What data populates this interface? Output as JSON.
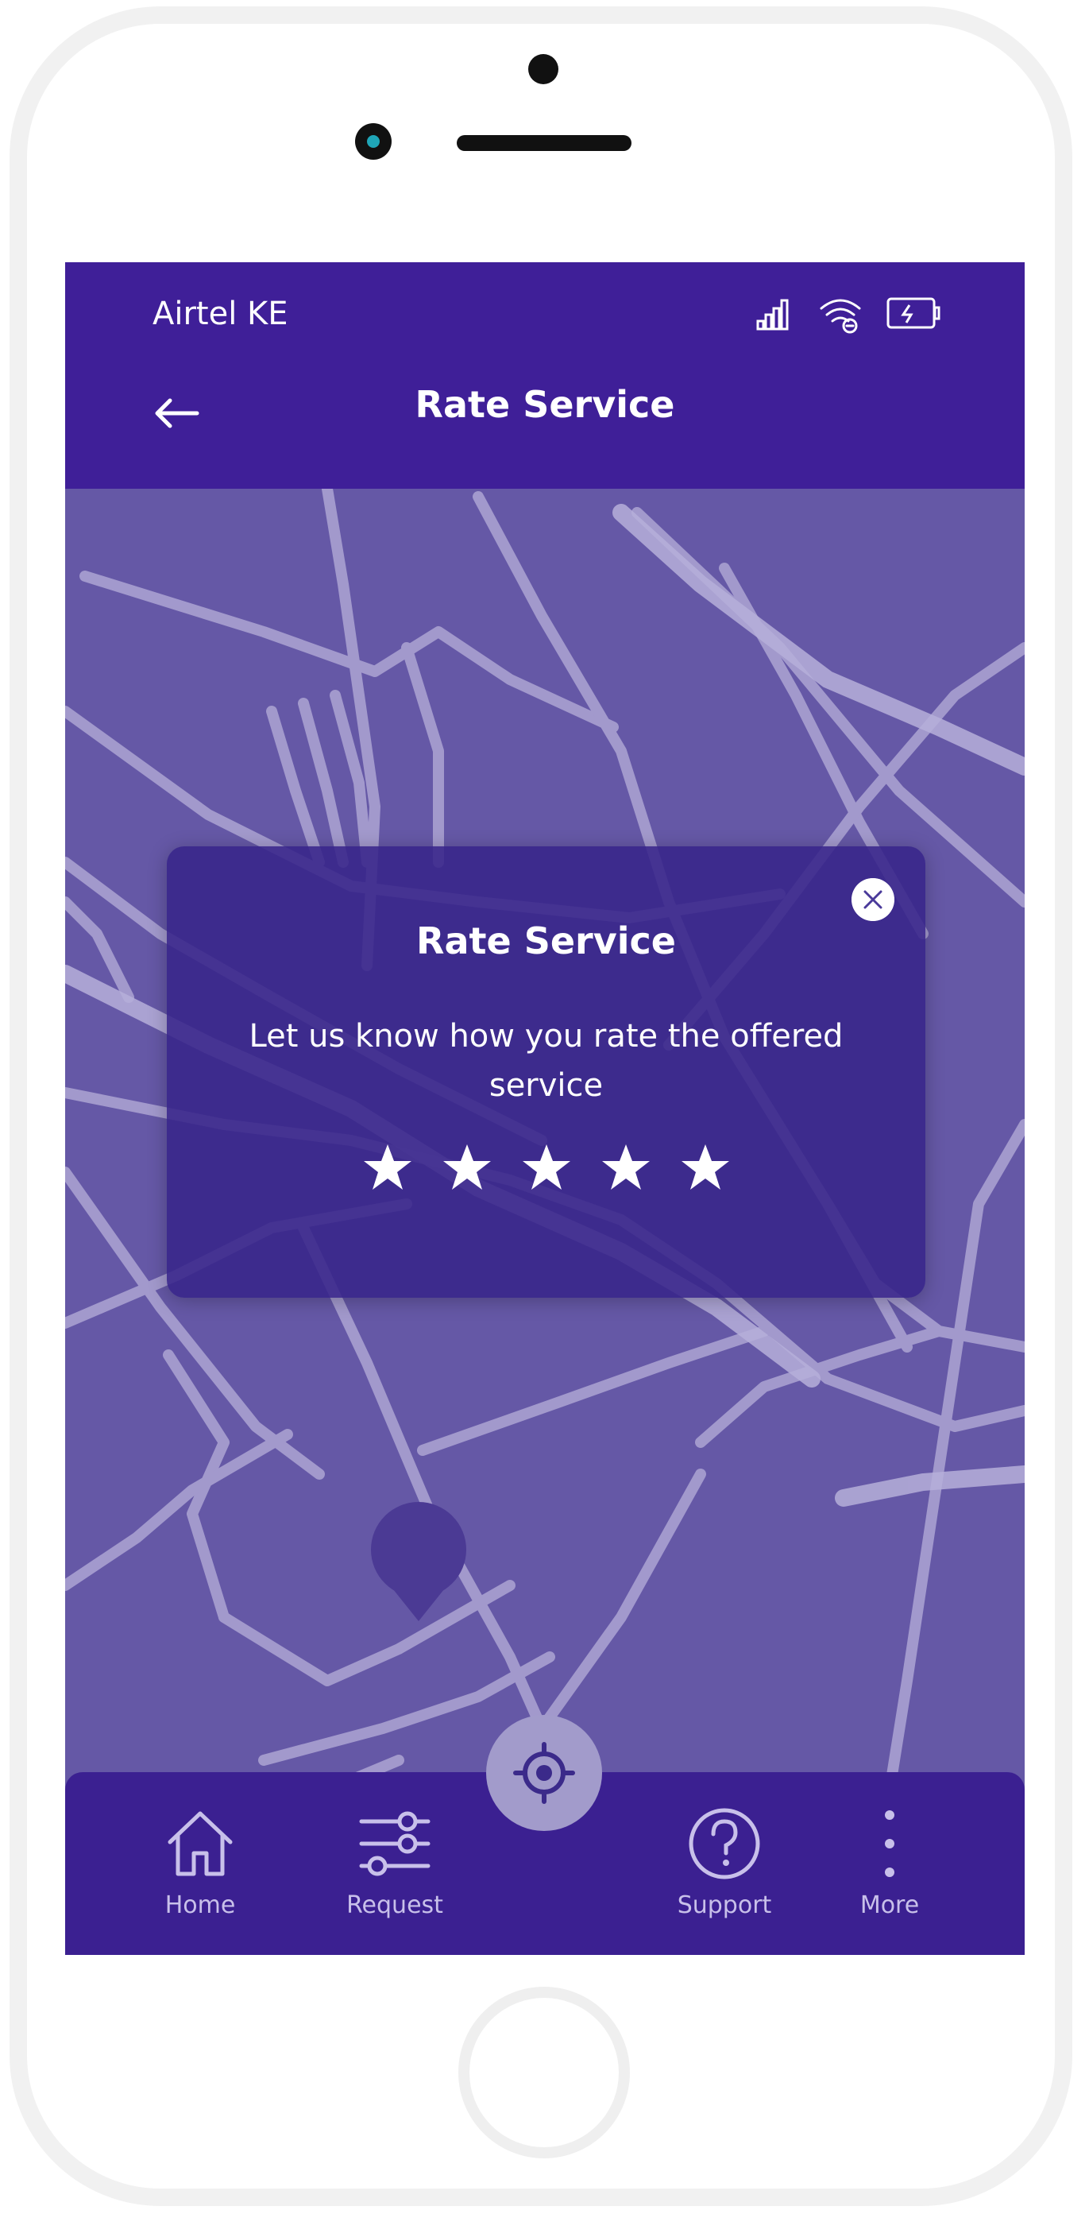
{
  "status_bar": {
    "carrier": "Airtel KE",
    "icons": [
      "signal-icon",
      "wifi-icon",
      "battery-icon"
    ]
  },
  "header": {
    "title": "Rate Service",
    "back_icon": "back-arrow-icon"
  },
  "modal": {
    "title": "Rate Service",
    "message": "Let us know how you rate the offered service",
    "close_icon": "close-icon",
    "stars": [
      "star-icon",
      "star-icon",
      "star-icon",
      "star-icon",
      "star-icon"
    ]
  },
  "bottom_nav": {
    "items": [
      {
        "label": "Home",
        "icon": "home-icon"
      },
      {
        "label": "Request",
        "icon": "sliders-icon"
      },
      {
        "label": "Support",
        "icon": "help-icon"
      },
      {
        "label": "More",
        "icon": "more-icon"
      }
    ],
    "center_icon": "locate-icon"
  },
  "colors": {
    "header_bg": "#3f1f98",
    "map_bg": "#6558a6",
    "modal_bg": "#38248a",
    "nav_bg": "#3b2091"
  }
}
